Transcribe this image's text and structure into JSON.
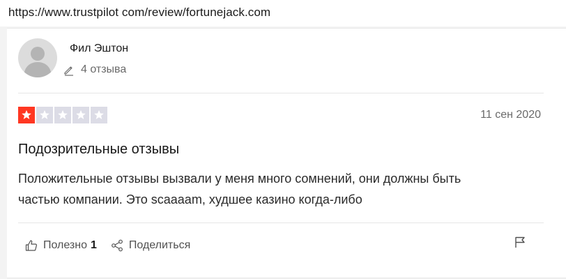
{
  "browser": {
    "url": "https://www.trustpilot com/review/fortunejack.com"
  },
  "review": {
    "reviewer": {
      "name": "Фил Эштон",
      "avatar_icon": "user-silhouette-icon"
    },
    "review_count_icon": "pencil-icon",
    "review_count_label": "4 отзыва",
    "rating": {
      "stars_filled": 1,
      "stars_total": 5,
      "filled_color": "#ff3722",
      "empty_color": "#dcdce6"
    },
    "date": "11 сен 2020",
    "title": "Подозрительные отзывы",
    "body_line_1": "Положительные отзывы вызвали у меня много сомнений, они должны быть",
    "body_line_2": "частью компании. Это scaaaam, худшее казино когда-либо",
    "actions": {
      "useful_icon": "thumbs-up-icon",
      "useful_label": "Полезно",
      "useful_count": "1",
      "share_icon": "share-icon",
      "share_label": "Поделиться",
      "flag_icon": "flag-icon"
    }
  }
}
